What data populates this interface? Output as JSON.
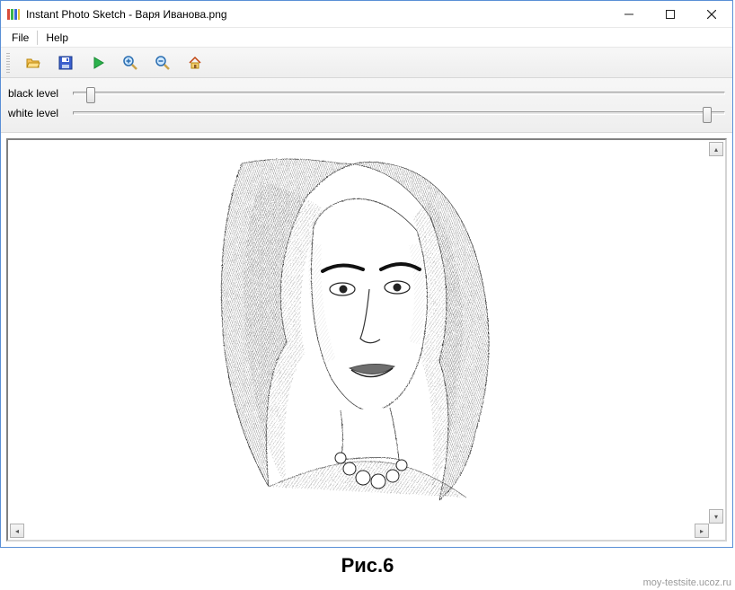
{
  "window": {
    "title": "Instant Photo Sketch - Варя Иванова.png"
  },
  "menu": {
    "file": "File",
    "help": "Help"
  },
  "toolbar": {
    "open": "open-icon",
    "save": "save-icon",
    "run": "play-icon",
    "zoom_in": "zoom-in-icon",
    "zoom_out": "zoom-out-icon",
    "home": "home-icon"
  },
  "sliders": {
    "black": {
      "label": "black level",
      "value": 2
    },
    "white": {
      "label": "white level",
      "value": 98
    }
  },
  "caption": "Рис.6",
  "watermark": "moy-testsite.ucoz.ru"
}
